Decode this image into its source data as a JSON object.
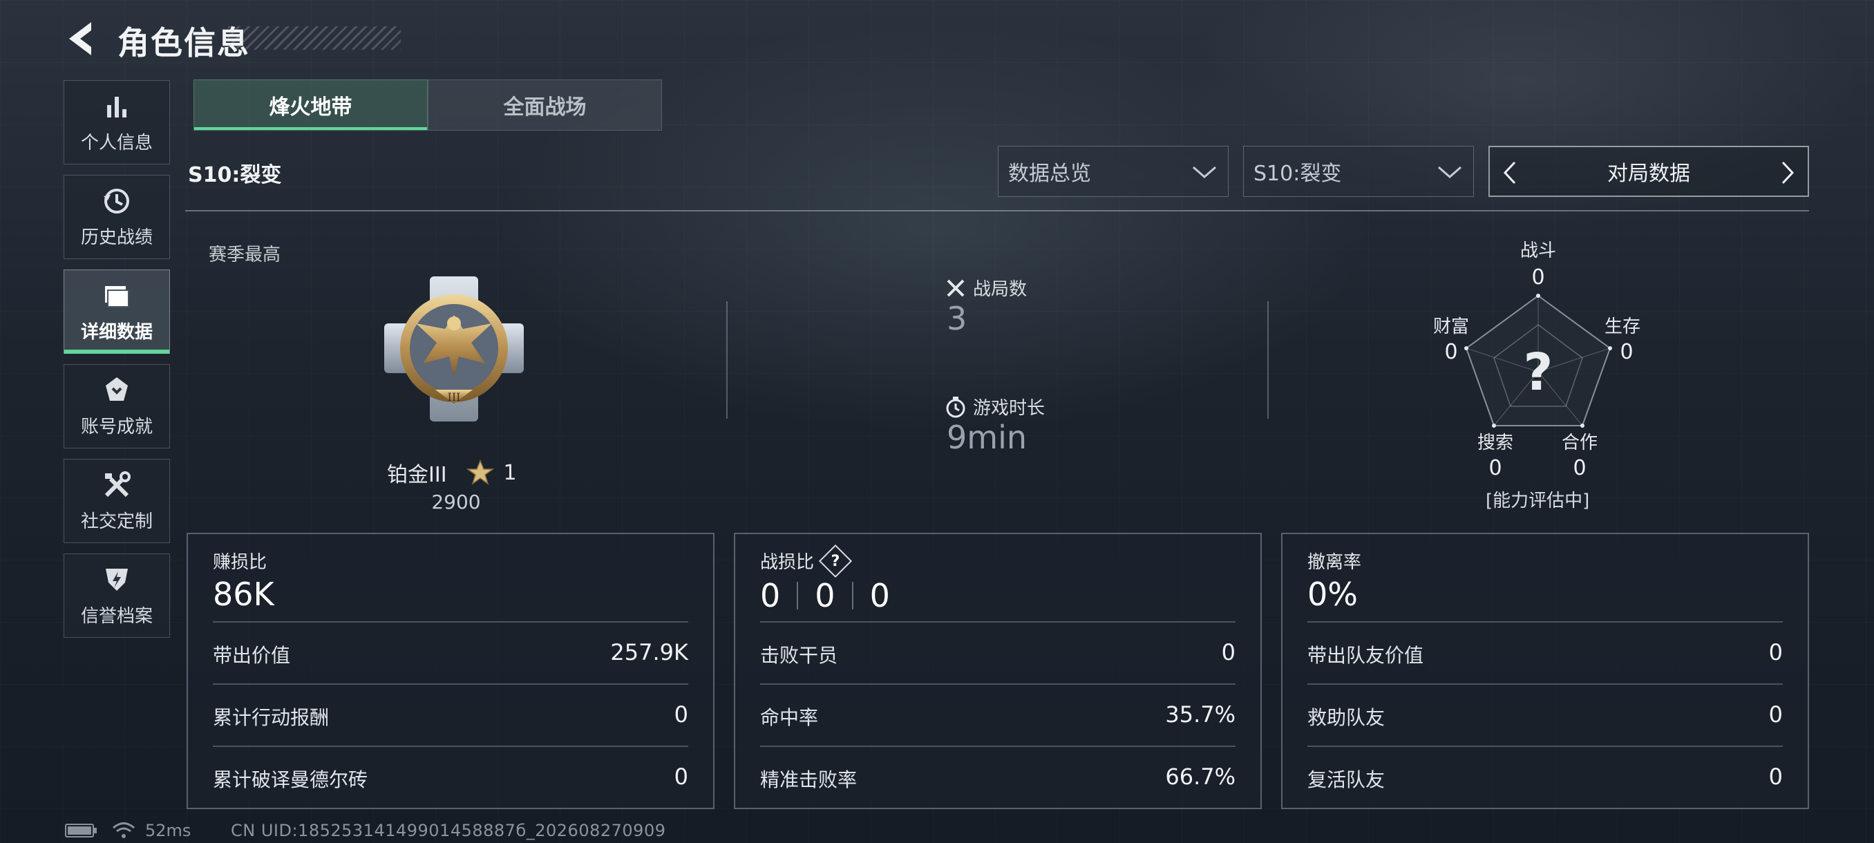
{
  "header": {
    "title": "角色信息"
  },
  "sidebar": {
    "items": [
      {
        "label": "个人信息",
        "icon": "bar-chart-icon"
      },
      {
        "label": "历史战绩",
        "icon": "history-icon"
      },
      {
        "label": "详细数据",
        "icon": "folder-icon",
        "active": true
      },
      {
        "label": "账号成就",
        "icon": "achievement-icon"
      },
      {
        "label": "社交定制",
        "icon": "tools-icon"
      },
      {
        "label": "信誉档案",
        "icon": "credit-shield-icon"
      }
    ]
  },
  "mode_tabs": [
    {
      "label": "烽火地带",
      "active": true
    },
    {
      "label": "全面战场",
      "active": false
    }
  ],
  "season": {
    "label": "S10:裂变"
  },
  "filters": {
    "overview": "数据总览",
    "season": "S10:裂变",
    "match_nav": "对局数据"
  },
  "season_best": {
    "label": "赛季最高",
    "rank": "铂金III",
    "stars": "1",
    "score": "2900",
    "medal_numeral": "III"
  },
  "summary": {
    "matches_label": "战局数",
    "matches_value": "3",
    "playtime_label": "游戏时长",
    "playtime_value": "9min"
  },
  "radar": {
    "combat_label": "战斗",
    "combat": "0",
    "survival_label": "生存",
    "survival": "0",
    "wealth_label": "财富",
    "wealth": "0",
    "search_label": "搜索",
    "search": "0",
    "coop_label": "合作",
    "coop": "0",
    "center": "?",
    "status": "[能力评估中]"
  },
  "panels": {
    "profit": {
      "title": "赚损比",
      "value": "86K",
      "rows": [
        {
          "label": "带出价值",
          "value": "257.9K"
        },
        {
          "label": "累计行动报酬",
          "value": "0"
        },
        {
          "label": "累计破译曼德尔砖",
          "value": "0"
        }
      ]
    },
    "combat": {
      "title": "战损比",
      "help": "?",
      "ratio": [
        "0",
        "0",
        "0"
      ],
      "rows": [
        {
          "label": "击败干员",
          "value": "0"
        },
        {
          "label": "命中率",
          "value": "35.7%"
        },
        {
          "label": "精准击败率",
          "value": "66.7%"
        }
      ]
    },
    "extract": {
      "title": "撤离率",
      "value": "0%",
      "rows": [
        {
          "label": "带出队友价值",
          "value": "0"
        },
        {
          "label": "救助队友",
          "value": "0"
        },
        {
          "label": "复活队友",
          "value": "0"
        }
      ]
    }
  },
  "footer": {
    "ping": "52ms",
    "uid": "CN UID:18525314149901458887б_202608270909"
  },
  "colors": {
    "accent": "#62d69b",
    "background": "#1d2530"
  }
}
